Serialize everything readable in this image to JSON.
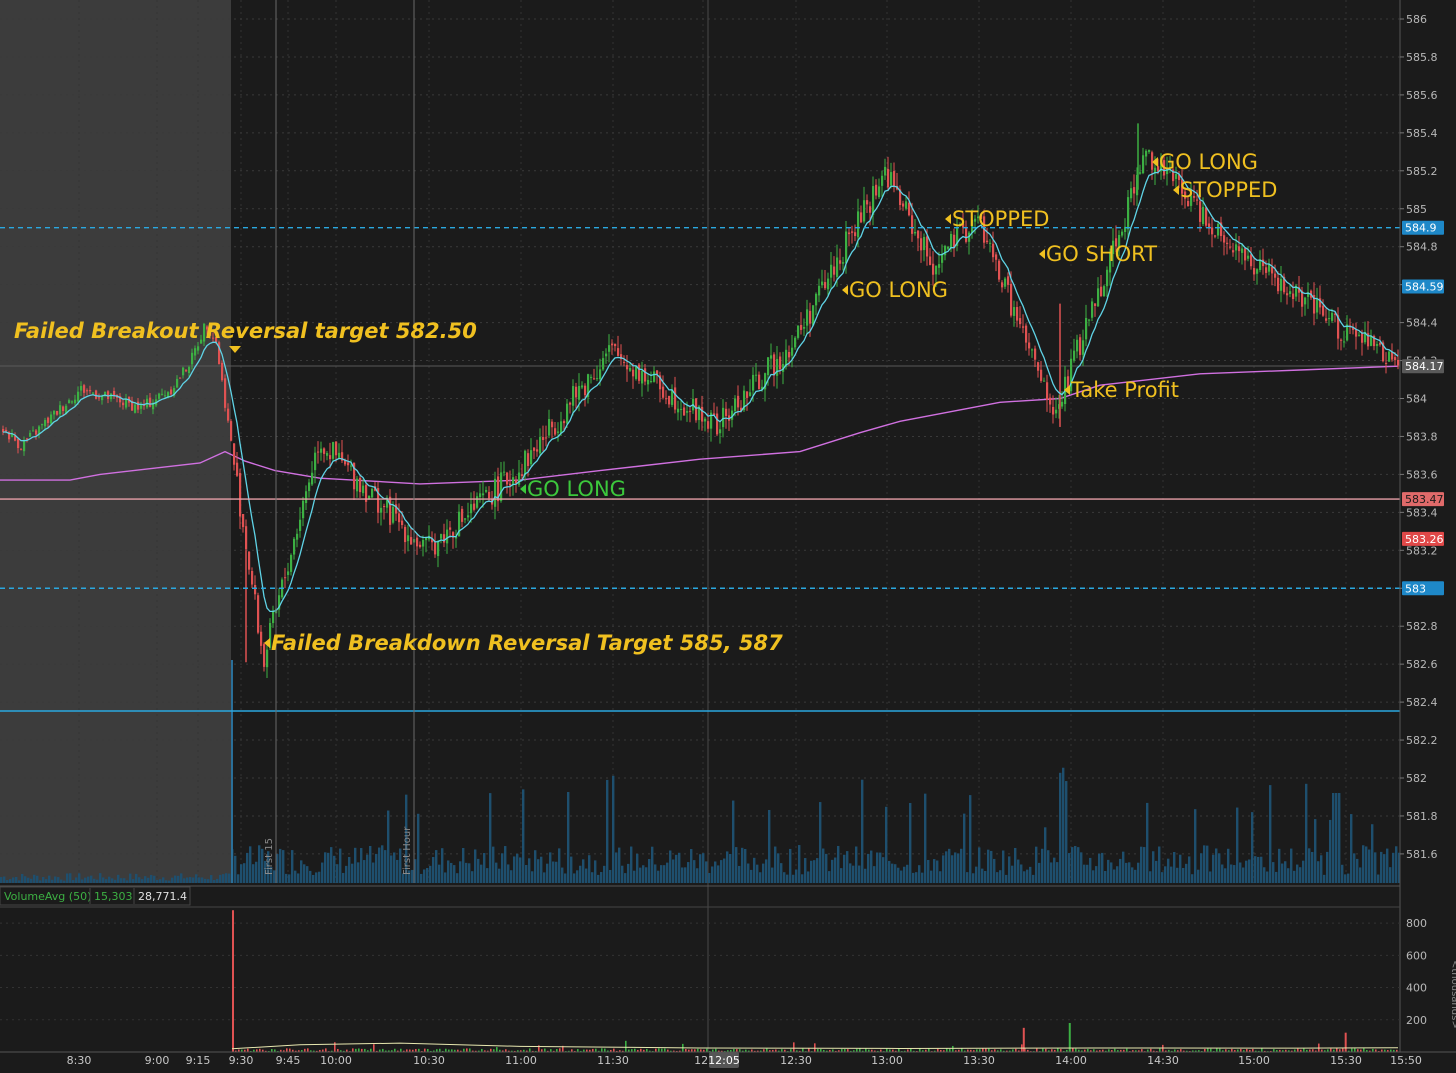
{
  "chart_data": [
    {
      "type": "candlestick",
      "panel": "price",
      "y_ticks": [
        "586",
        "585.8",
        "585.6",
        "585.4",
        "585.2",
        "585",
        "584.8",
        "584.6",
        "584.4",
        "584.2",
        "584",
        "583.8",
        "583.6",
        "583.4",
        "583.2",
        "583",
        "582.8",
        "582.6",
        "582.4",
        "582.2",
        "582",
        "581.8",
        "581.6"
      ],
      "ylim": [
        581.5,
        586.1
      ],
      "x_ticks": [
        "8:30",
        "9:00",
        "9:15",
        "9:30",
        "9:45",
        "10:00",
        "10:30",
        "11:00",
        "11:30",
        "12:",
        "12:05",
        "12:30",
        "13:00",
        "13:30",
        "14:00",
        "14:30",
        "15:00",
        "15:30",
        "15:50"
      ],
      "price_tags": [
        {
          "label": "584.9",
          "value": 584.9,
          "bg": "#1e88c8",
          "fg": "#ffffff"
        },
        {
          "label": "584.59",
          "value": 584.59,
          "bg": "#1e88c8",
          "fg": "#ffffff"
        },
        {
          "label": "584.17",
          "value": 584.17,
          "bg": "#5a5a5a",
          "fg": "#ffffff"
        },
        {
          "label": "583.47",
          "value": 583.47,
          "bg": "#e06a6a",
          "fg": "#1b1b1b"
        },
        {
          "label": "583.26",
          "value": 583.26,
          "bg": "#e04848",
          "fg": "#ffffff"
        },
        {
          "label": "583",
          "value": 583.0,
          "bg": "#1e88c8",
          "fg": "#ffffff"
        }
      ],
      "levels": [
        {
          "value": 584.9,
          "style": "dashed",
          "color": "#2aa8e0"
        },
        {
          "value": 583.0,
          "style": "dashed",
          "color": "#2aa8e0"
        },
        {
          "value": 583.47,
          "style": "solid",
          "color": "#e8a0a8"
        },
        {
          "value": 582.36,
          "style": "solid",
          "color": "#2aa8e0"
        }
      ],
      "vertical_markers": [
        "First 15",
        "First Hour"
      ],
      "annotations": [
        {
          "text": "Failed Breakout Reversal target 582.50",
          "color": "#f0c020"
        },
        {
          "text": "Failed Breakdown Reversal Target 585, 587",
          "color": "#f0c020"
        },
        {
          "text": "GO LONG",
          "color": "#3cc83c"
        },
        {
          "text": "GO LONG",
          "color": "#f0c020"
        },
        {
          "text": "STOPPED",
          "color": "#f0c020"
        },
        {
          "text": "GO SHORT",
          "color": "#f0c020"
        },
        {
          "text": "Take Profit",
          "color": "#f0c020"
        },
        {
          "text": "GO LONG",
          "color": "#f0c020"
        },
        {
          "text": "STOPPED",
          "color": "#f0c020"
        }
      ],
      "series": [
        {
          "name": "candles",
          "color_up": "#3cb043",
          "color_down": "#e05252"
        },
        {
          "name": "fast MA",
          "color": "#5fd3e6"
        },
        {
          "name": "VWAP",
          "color": "#d070e0"
        }
      ],
      "key_prices": [
        {
          "time": "9:15",
          "price": 584.45
        },
        {
          "time": "9:37",
          "price": 582.61
        },
        {
          "time": "9:55",
          "price": 583.78
        },
        {
          "time": "10:30",
          "price": 583.2
        },
        {
          "time": "11:00",
          "price": 583.62
        },
        {
          "time": "11:30",
          "price": 584.25
        },
        {
          "time": "12:05",
          "price": 583.85
        },
        {
          "time": "12:30",
          "price": 584.3
        },
        {
          "time": "13:00",
          "price": 585.2
        },
        {
          "time": "13:15",
          "price": 584.7
        },
        {
          "time": "13:30",
          "price": 584.95
        },
        {
          "time": "13:55",
          "price": 583.9
        },
        {
          "time": "14:25",
          "price": 585.3
        },
        {
          "time": "14:45",
          "price": 584.95
        },
        {
          "time": "15:00",
          "price": 584.7
        },
        {
          "time": "15:30",
          "price": 584.35
        },
        {
          "time": "15:50",
          "price": 584.17
        }
      ],
      "volume_bars_note": "volume overlay in bottom of price panel"
    },
    {
      "type": "bar",
      "panel": "volume",
      "legend": {
        "name": "VolumeAvg (50)",
        "value1": "15,303",
        "value2": "28,771.4"
      },
      "y_ticks": [
        "800",
        "600",
        "400",
        "200"
      ],
      "ylabel": "<thousands>",
      "ylim": [
        0,
        900
      ],
      "spikes": [
        {
          "time": "9:30",
          "value": 880
        },
        {
          "time": "13:45",
          "value": 150
        },
        {
          "time": "14:00",
          "value": 180
        },
        {
          "time": "15:30",
          "value": 120
        }
      ]
    }
  ]
}
